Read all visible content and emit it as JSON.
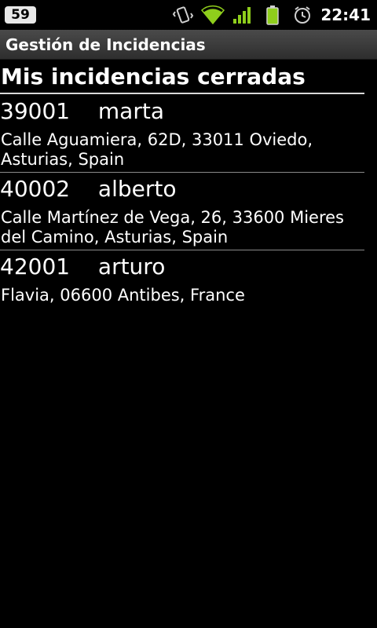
{
  "status_bar": {
    "notification_count": "59",
    "time": "22:41",
    "icons": [
      "vibrate-icon",
      "wifi-icon",
      "signal-icon",
      "battery-icon",
      "alarm-icon"
    ]
  },
  "app": {
    "title": "Gestión de Incidencias"
  },
  "screen": {
    "heading": "Mis incidencias cerradas"
  },
  "incidents": [
    {
      "id": "39001",
      "user": "marta",
      "address": "Calle Aguamiera, 62D, 33011 Oviedo, Asturias, Spain"
    },
    {
      "id": "40002",
      "user": "alberto",
      "address": "Calle Martínez de Vega, 26, 33600 Mieres del Camino, Asturias, Spain"
    },
    {
      "id": "42001",
      "user": "arturo",
      "address": "Flavia, 06600 Antibes, France"
    }
  ]
}
